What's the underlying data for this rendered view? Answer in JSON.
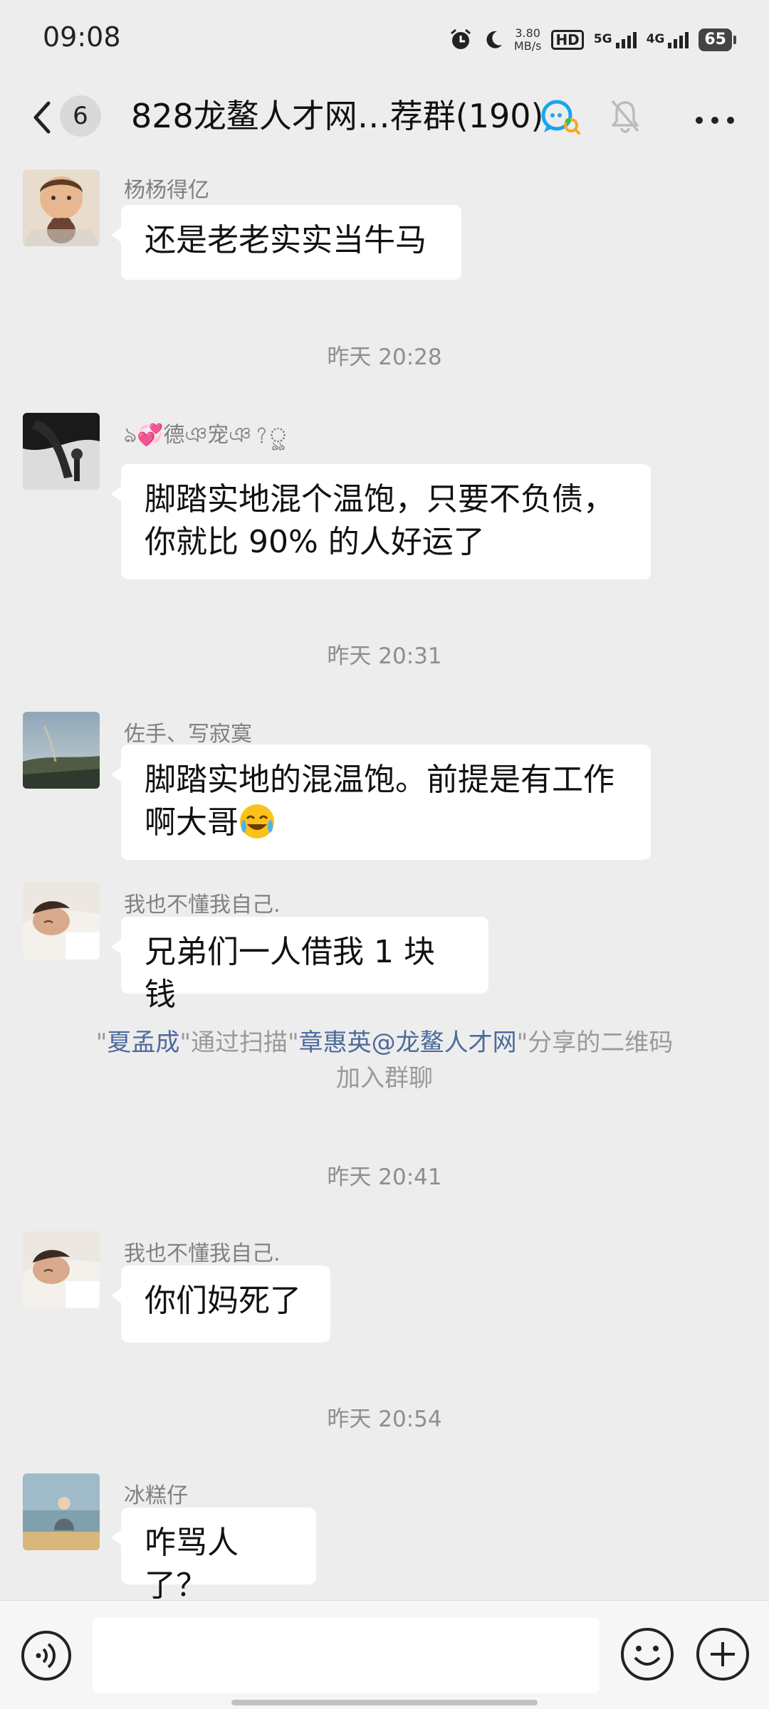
{
  "status": {
    "time": "09:08",
    "speed_value": "3.80",
    "speed_unit": "MB/s",
    "hd": "HD",
    "network_5g": "5G",
    "network_4g": "4G",
    "battery": "65"
  },
  "header": {
    "unread_count": "6",
    "title": "828龙鳌人才网…荐群(190)"
  },
  "messages": [
    {
      "sender": "杨杨得亿",
      "text": "还是老老实实当牛马"
    },
    {
      "time": "昨天 20:28"
    },
    {
      "sender": "ঌ💞德ঞ宠ঞ?ৣ",
      "text_line1": "脚踏实地混个温饱，只要不负债，",
      "text_line2": "你就比 90% 的人好运了"
    },
    {
      "time": "昨天 20:31"
    },
    {
      "sender": "佐手、写寂寞",
      "text_line1": "脚踏实地的混温饱。前提是有工作",
      "text_line2": "啊大哥"
    },
    {
      "sender": "我也不懂我自己.",
      "text": "兄弟们一人借我 1 块钱"
    },
    {
      "system": {
        "q1": "\"",
        "name1": "夏孟成",
        "mid": "\"通过扫描\"",
        "name2": "章惠英@龙鳌人才网",
        "end": "\"分享的二维码",
        "line2": "加入群聊"
      }
    },
    {
      "time": "昨天 20:41"
    },
    {
      "sender": "我也不懂我自己.",
      "text": "你们妈死了"
    },
    {
      "time": "昨天 20:54"
    },
    {
      "sender": "冰糕仔",
      "text": "咋骂人了？"
    }
  ],
  "colors": {
    "background": "#ededed",
    "bubble": "#ffffff",
    "link": "#4d6a9d",
    "muted": "#8e8e8e"
  },
  "icons": [
    "back-chevron-icon",
    "chat-search-icon",
    "muted-bell-icon",
    "more-dots-icon",
    "voice-icon",
    "emoji-icon",
    "plus-icon"
  ]
}
